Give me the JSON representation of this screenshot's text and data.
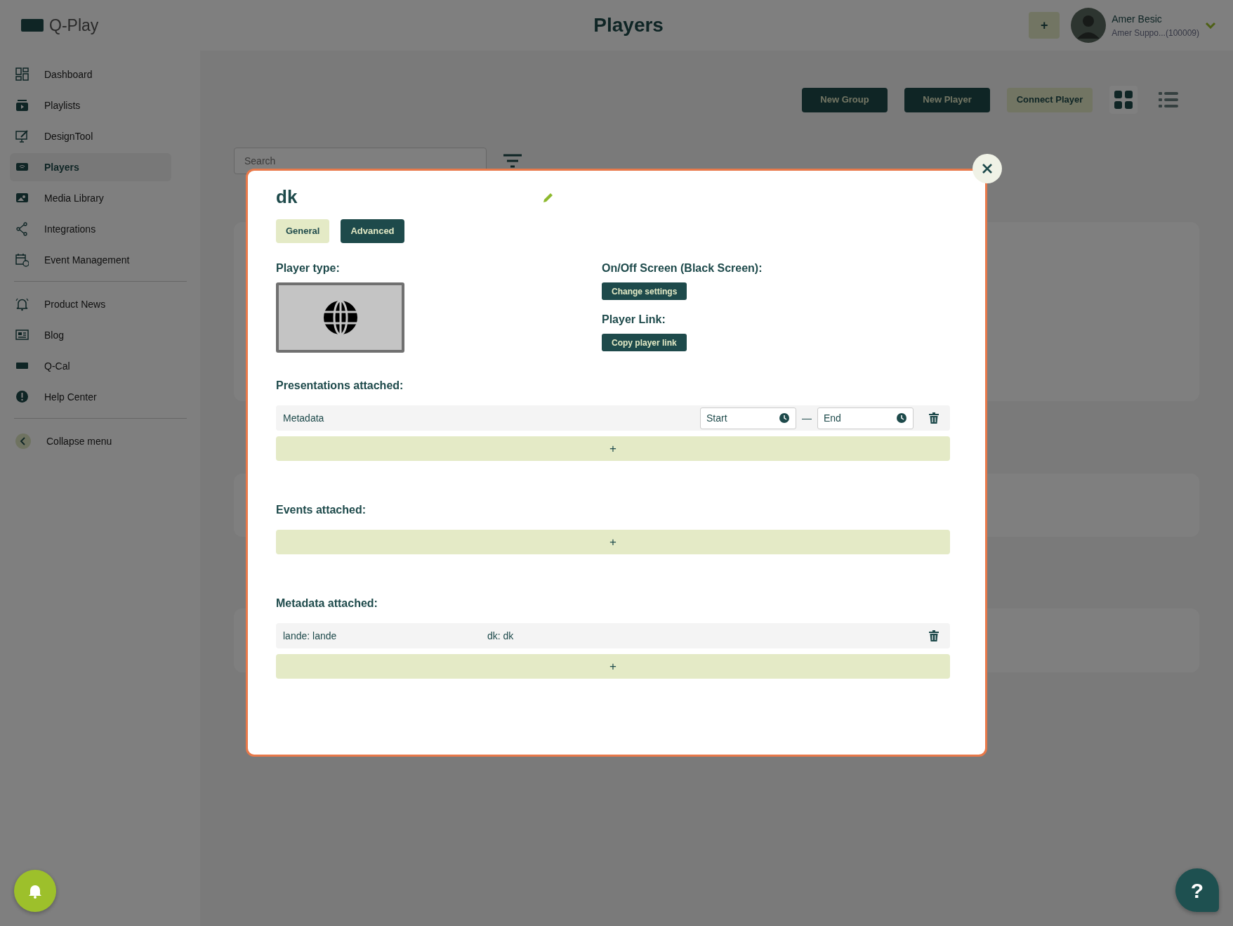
{
  "app": {
    "logo": "Q-Play",
    "page_title": "Players"
  },
  "header": {
    "add_button": "+",
    "user": {
      "name": "Amer Besic",
      "account": "Amer Suppo...(100009)"
    }
  },
  "sidebar": {
    "groups": [
      [
        {
          "label": "Dashboard",
          "selected": false
        },
        {
          "label": "Playlists",
          "selected": false
        },
        {
          "label": "DesignTool",
          "selected": false
        },
        {
          "label": "Players",
          "selected": true
        },
        {
          "label": "Media Library",
          "selected": false
        },
        {
          "label": "Integrations",
          "selected": false
        },
        {
          "label": "Event Management",
          "selected": false
        }
      ],
      [
        {
          "label": "Product News",
          "selected": false
        },
        {
          "label": "Blog",
          "selected": false
        },
        {
          "label": "Q-Cal",
          "selected": false
        },
        {
          "label": "Help Center",
          "selected": false
        }
      ]
    ],
    "collapse": "Collapse menu"
  },
  "toolbar": {
    "buttons": [
      {
        "label": "New Group",
        "kind": "dark"
      },
      {
        "label": "New Player",
        "kind": "dark"
      },
      {
        "label": "Connect Player",
        "kind": "light"
      }
    ],
    "views": [
      {
        "kind": "grid",
        "selected": true
      },
      {
        "kind": "list",
        "selected": false
      }
    ]
  },
  "search": {
    "placeholder": "Search"
  },
  "modal": {
    "title": "dk",
    "tabs": [
      {
        "label": "General",
        "selected": false
      },
      {
        "label": "Advanced",
        "selected": true
      }
    ],
    "player_type_label": "Player type:",
    "screen_label": "On/Off Screen (Black Screen):",
    "screen_button": "Change settings",
    "link_label": "Player Link:",
    "link_button": "Copy player link",
    "presentations": {
      "heading": "Presentations attached:",
      "rows": [
        {
          "name": "Metadata",
          "start_placeholder": "Start",
          "separator": "—",
          "end_placeholder": "End"
        }
      ],
      "add": "+"
    },
    "events": {
      "heading": "Events attached:",
      "add": "+"
    },
    "metadata": {
      "heading": "Metadata attached:",
      "rows": [
        {
          "cells": [
            "lande: lande",
            "dk: dk"
          ]
        }
      ],
      "add": "+"
    }
  },
  "help_button": "?"
}
